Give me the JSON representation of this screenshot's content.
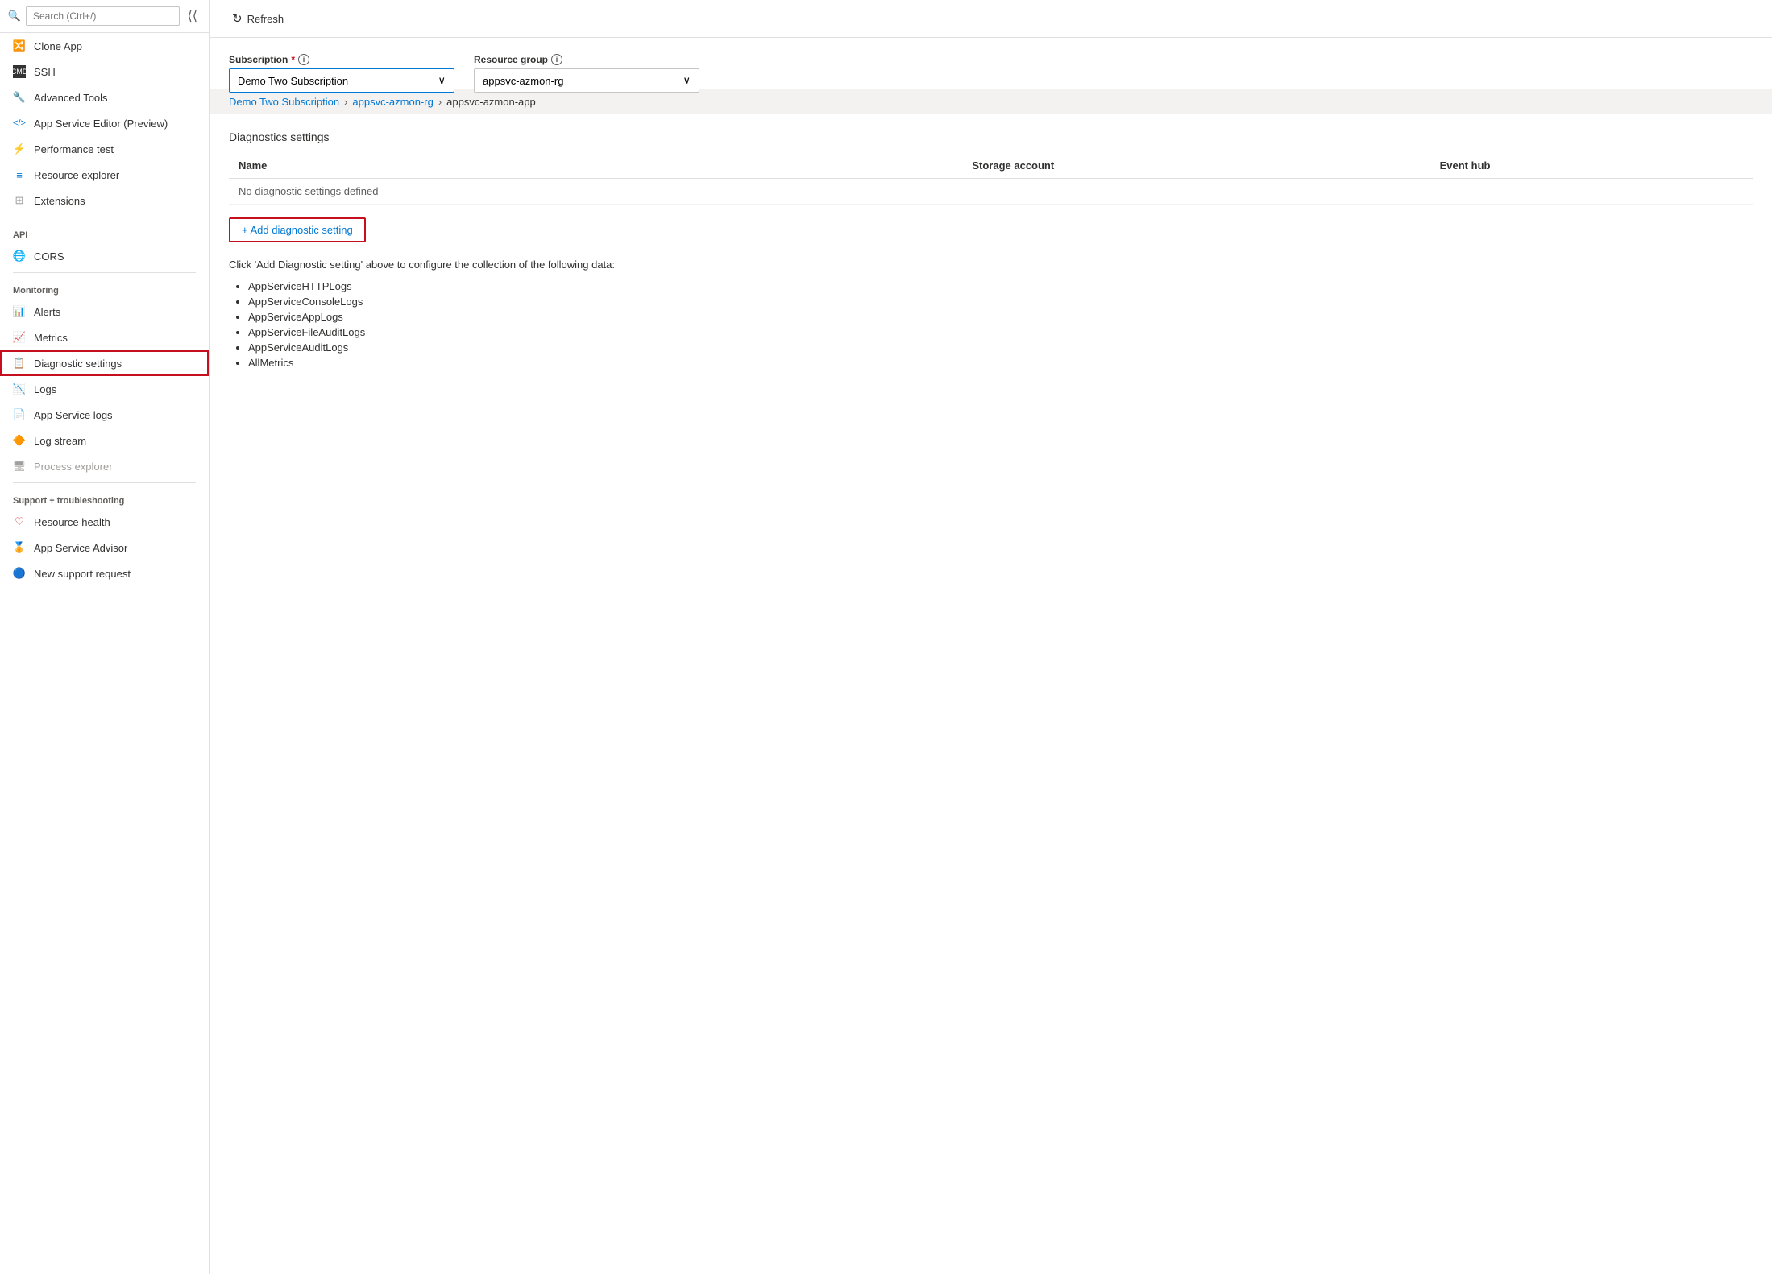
{
  "sidebar": {
    "search_placeholder": "Search (Ctrl+/)",
    "items": [
      {
        "id": "clone-app",
        "label": "Clone App",
        "icon": "🔀",
        "icon_class": "icon-teal",
        "disabled": false,
        "active": false
      },
      {
        "id": "ssh",
        "label": "SSH",
        "icon": "⬛",
        "icon_class": "",
        "disabled": false,
        "active": false
      },
      {
        "id": "advanced-tools",
        "label": "Advanced Tools",
        "icon": "🔧",
        "icon_class": "icon-blue",
        "disabled": false,
        "active": false
      },
      {
        "id": "app-service-editor",
        "label": "App Service Editor (Preview)",
        "icon": "</>",
        "icon_class": "icon-blue",
        "disabled": false,
        "active": false
      },
      {
        "id": "performance-test",
        "label": "Performance test",
        "icon": "⚡",
        "icon_class": "icon-teal",
        "disabled": false,
        "active": false
      },
      {
        "id": "resource-explorer",
        "label": "Resource explorer",
        "icon": "≡",
        "icon_class": "icon-blue",
        "disabled": false,
        "active": false
      },
      {
        "id": "extensions",
        "label": "Extensions",
        "icon": "⊞",
        "icon_class": "icon-gray",
        "disabled": false,
        "active": false
      }
    ],
    "api_section": "API",
    "api_items": [
      {
        "id": "cors",
        "label": "CORS",
        "icon": "🌐",
        "icon_class": "icon-blue",
        "disabled": false,
        "active": false
      }
    ],
    "monitoring_section": "Monitoring",
    "monitoring_items": [
      {
        "id": "alerts",
        "label": "Alerts",
        "icon": "📊",
        "icon_class": "icon-green-chart",
        "disabled": false,
        "active": false
      },
      {
        "id": "metrics",
        "label": "Metrics",
        "icon": "📈",
        "icon_class": "icon-blue",
        "disabled": false,
        "active": false
      },
      {
        "id": "diagnostic-settings",
        "label": "Diagnostic settings",
        "icon": "📋",
        "icon_class": "icon-green-chart",
        "disabled": false,
        "active": true
      },
      {
        "id": "logs",
        "label": "Logs",
        "icon": "📉",
        "icon_class": "icon-blue",
        "disabled": false,
        "active": false
      },
      {
        "id": "app-service-logs",
        "label": "App Service logs",
        "icon": "📄",
        "icon_class": "icon-purple",
        "disabled": false,
        "active": false
      },
      {
        "id": "log-stream",
        "label": "Log stream",
        "icon": "🔶",
        "icon_class": "icon-orange",
        "disabled": false,
        "active": false
      },
      {
        "id": "process-explorer",
        "label": "Process explorer",
        "icon": "🖥",
        "icon_class": "icon-gray",
        "disabled": false,
        "active": false
      }
    ],
    "support_section": "Support + troubleshooting",
    "support_items": [
      {
        "id": "resource-health",
        "label": "Resource health",
        "icon": "♡",
        "icon_class": "icon-red",
        "disabled": false,
        "active": false
      },
      {
        "id": "app-service-advisor",
        "label": "App Service Advisor",
        "icon": "🏅",
        "icon_class": "icon-blue",
        "disabled": false,
        "active": false
      },
      {
        "id": "new-support-request",
        "label": "New support request",
        "icon": "🔵",
        "icon_class": "icon-blue",
        "disabled": false,
        "active": false
      }
    ]
  },
  "toolbar": {
    "refresh_label": "Refresh"
  },
  "form": {
    "subscription_label": "Subscription",
    "subscription_required": "*",
    "subscription_value": "Demo Two Subscription",
    "resource_group_label": "Resource group",
    "resource_group_value": "appsvc-azmon-rg"
  },
  "breadcrumb": {
    "items": [
      {
        "id": "subscription",
        "label": "Demo Two Subscription",
        "link": true
      },
      {
        "id": "resource-group",
        "label": "appsvc-azmon-rg",
        "link": true
      },
      {
        "id": "app",
        "label": "appsvc-azmon-app",
        "link": false
      }
    ]
  },
  "diagnostics": {
    "section_title": "Diagnostics settings",
    "columns": [
      "Name",
      "Storage account",
      "Event hub"
    ],
    "empty_message": "No diagnostic settings defined",
    "add_button_label": "+ Add diagnostic setting",
    "description": "Click 'Add Diagnostic setting' above to configure the collection of the following data:",
    "items": [
      "AppServiceHTTPLogs",
      "AppServiceConsoleLogs",
      "AppServiceAppLogs",
      "AppServiceFileAuditLogs",
      "AppServiceAuditLogs",
      "AllMetrics"
    ]
  }
}
